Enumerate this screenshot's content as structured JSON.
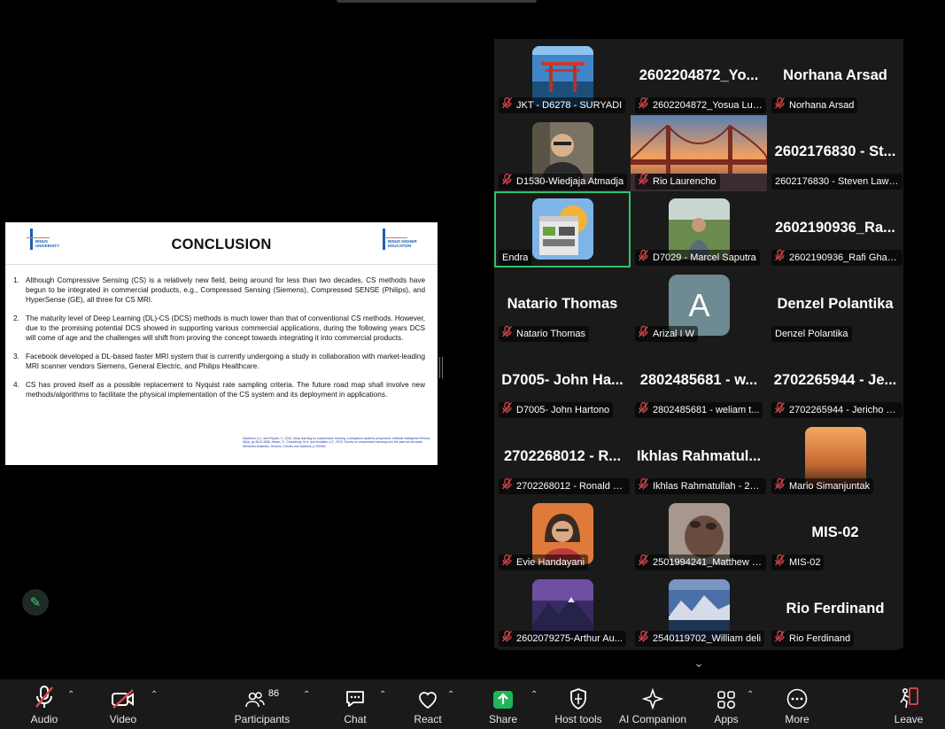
{
  "slide": {
    "title": "CONCLUSION",
    "logo_left": "BINUS UNIVERSITY",
    "logo_right": "BINUS HIGHER EDUCATION",
    "items": [
      {
        "num": "1.",
        "text": "Although Compressive Sensing (CS) is a relatively new field, being around for less than two decades, CS methods have begun to be integrated in commercial products, e.g., Compressed Sensing (Siemens), Compressed SENSE (Philips), and HyperSense (GE), all three for CS MRI."
      },
      {
        "num": "2.",
        "text": "The maturity level of Deep Learning (DL)-CS (DCS) methods is much lower than that of conventional CS methods. However, due to the promising potential DCS showed in supporting various commercial applications, during the following years DCS will come of age and the challenges will shift from proving the concept towards integrating it into commercial products."
      },
      {
        "num": "3.",
        "text": "Facebook developed a DL-based faster MRI system that is currently undergoing a study in collaboration with market-leading MRI scanner vendors Siemens, General Electric, and Philips Healthcare."
      },
      {
        "num": "4.",
        "text": "CS has proved itself as a possible replacement to Nyquist rate sampling criteria. The future road map shall involve new methods/algorithms to facilitate the physical implementation of the CS system and its deployment in applications."
      }
    ],
    "references": "Machidon, A.L. and Pejović, V., 2023. Deep learning for compressive sensing: a ubiquitous systems perspective. Artificial Intelligence Review, 56(4), pp.3619-3658. Hasan, S., Chowdhury, M.H. and Abdullah, A.T., 2023. Survey on compressive sensing over the past two decades. Memories-Materials, Devices, Circuits and Systems, p.100060."
  },
  "participants_tiles": [
    {
      "label": "JKT - D6278 - SURYADI",
      "big": "",
      "kind": "photo-torii",
      "muted": true
    },
    {
      "label": "2602204872_Yosua Lum...",
      "big": "2602204872_Yo...",
      "kind": "name",
      "muted": true
    },
    {
      "label": "Norhana Arsad",
      "big": "Norhana Arsad",
      "kind": "name",
      "muted": true
    },
    {
      "label": "D1530-Wiedjaja Atmadja",
      "big": "",
      "kind": "photo-man",
      "muted": true
    },
    {
      "label": "Rio Laurencho",
      "big": "",
      "kind": "photo-bridge",
      "muted": true
    },
    {
      "label": "2602176830 - Steven Lawr...",
      "big": "2602176830 - St...",
      "kind": "name",
      "muted": false
    },
    {
      "label": "Endra",
      "big": "",
      "kind": "photo-building",
      "muted": false,
      "active": true
    },
    {
      "label": "D7029 - Marcel Saputra",
      "big": "",
      "kind": "photo-field",
      "muted": true
    },
    {
      "label": "2602190936_Rafi Ghazi B",
      "big": "2602190936_Ra...",
      "kind": "name",
      "muted": true
    },
    {
      "label": "Natario Thomas",
      "big": "Natario Thomas",
      "kind": "name",
      "muted": true
    },
    {
      "label": "Arizal I W",
      "big": "",
      "kind": "letter",
      "letter": "A",
      "muted": true
    },
    {
      "label": "Denzel Polantika",
      "big": "Denzel Polantika",
      "kind": "name",
      "muted": false
    },
    {
      "label": "D7005- John Hartono",
      "big": "D7005- John Ha...",
      "kind": "name",
      "muted": true
    },
    {
      "label": "2802485681 - weliam t...",
      "big": "2802485681 - w...",
      "kind": "name",
      "muted": true
    },
    {
      "label": "2702265944 - Jericho J...",
      "big": "2702265944 - Je...",
      "kind": "name",
      "muted": true
    },
    {
      "label": "2702268012 - Ronald C...",
      "big": "2702268012 - R...",
      "kind": "name",
      "muted": true
    },
    {
      "label": "Ikhlas Rahmatullah - 27...",
      "big": "Ikhlas Rahmatul...",
      "kind": "name",
      "muted": true
    },
    {
      "label": "Mario Simanjuntak",
      "big": "",
      "kind": "photo-sunset",
      "muted": true
    },
    {
      "label": "Evie Handayani",
      "big": "",
      "kind": "photo-woman",
      "muted": true
    },
    {
      "label": "2501994241_Matthew F...",
      "big": "",
      "kind": "photo-blur",
      "muted": true
    },
    {
      "label": "MIS-02",
      "big": "MIS-02",
      "kind": "name",
      "muted": true
    },
    {
      "label": "2602079275-Arthur Au...",
      "big": "",
      "kind": "photo-mountain",
      "muted": true
    },
    {
      "label": "2540119702_William deli",
      "big": "",
      "kind": "photo-lake",
      "muted": true
    },
    {
      "label": "Rio Ferdinand",
      "big": "Rio Ferdinand",
      "kind": "name",
      "muted": true
    }
  ],
  "toolbar": {
    "audio": "Audio",
    "video": "Video",
    "participants": "Participants",
    "participants_count": "86",
    "chat": "Chat",
    "react": "React",
    "share": "Share",
    "host_tools": "Host tools",
    "ai_companion": "AI Companion",
    "apps": "Apps",
    "more": "More",
    "leave": "Leave"
  },
  "colors": {
    "accent_green": "#31c26f",
    "muted_red": "#e0474c",
    "share_green": "#1fb65a"
  }
}
